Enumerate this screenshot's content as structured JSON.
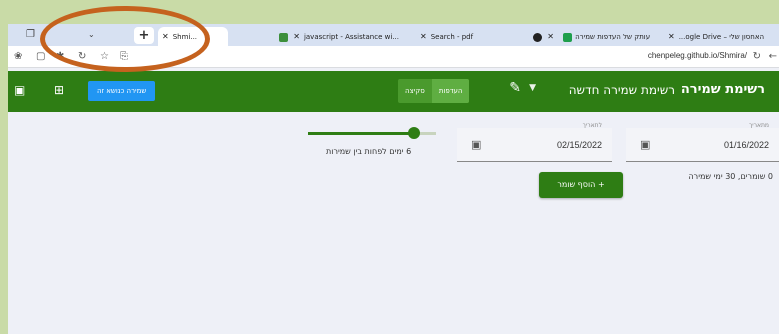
{
  "browser": {
    "tabs": [
      {
        "label": "Shmi...",
        "active": true
      },
      {
        "label": "javascript - Assistance wi..."
      },
      {
        "label": "Search - pdf"
      },
      {
        "label": "עותק של העדפות שמירה"
      },
      {
        "label": "...ogle Drive – האחסון שלי"
      }
    ],
    "new_tab_symbol": "+",
    "url": "chenpeleg.github.io/Shmira/"
  },
  "app": {
    "title": "רשימת שמירה",
    "list_name": "רשימת שמירה חדשה",
    "tabs": [
      "העדפות",
      "סקיצה"
    ],
    "save_button": "שמירה כנושא זה"
  },
  "form": {
    "start_label": "מתאריך",
    "start_value": "01/16/2022",
    "end_label": "לתאריך",
    "end_value": "02/15/2022",
    "slider_label": "6 ימים לפחות בין שמירות",
    "slider_fraction": 0.83,
    "summary": "0 שומרים, 30 ימי שמירה",
    "add_button": "+ הוסף שומר"
  },
  "colors": {
    "app_green": "#2e7d14",
    "save_blue": "#2196f3",
    "annotation": "#c5621e"
  }
}
